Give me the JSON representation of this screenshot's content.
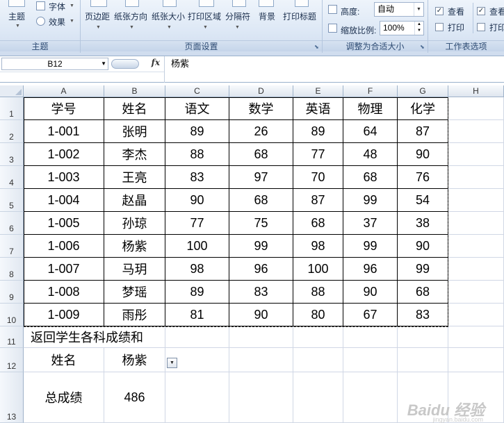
{
  "ribbon": {
    "themes_group": {
      "label": "主题",
      "theme_button": "主题",
      "fonts_button": "字体",
      "effects_button": "效果"
    },
    "page_setup_group": {
      "label": "页面设置",
      "buttons": [
        "页边距",
        "纸张方向",
        "纸张大小",
        "打印区域",
        "分隔符",
        "背景",
        "打印标题"
      ]
    },
    "scale_group": {
      "label": "调整为合适大小",
      "height_label": "高度:",
      "height_value": "自动",
      "scale_label": "缩放比例:",
      "scale_value": "100%"
    },
    "sheet_options_group": {
      "label": "工作表选项",
      "view_label": "查看",
      "print_label": "打印",
      "view_label_2": "查看",
      "print_label_2": "打印",
      "view_checked": true,
      "print_checked": false
    }
  },
  "formula_bar": {
    "name_box": "B12",
    "fx_label": "fx",
    "value": "杨紫"
  },
  "grid": {
    "columns": [
      "A",
      "B",
      "C",
      "D",
      "E",
      "F",
      "G",
      "H"
    ],
    "rows": [
      "1",
      "2",
      "3",
      "4",
      "5",
      "6",
      "7",
      "8",
      "9",
      "10",
      "11",
      "12",
      "13"
    ],
    "table_header": [
      "学号",
      "姓名",
      "语文",
      "数学",
      "英语",
      "物理",
      "化学"
    ],
    "table_rows": [
      [
        "1-001",
        "张明",
        "89",
        "26",
        "89",
        "64",
        "87"
      ],
      [
        "1-002",
        "李杰",
        "88",
        "68",
        "77",
        "48",
        "90"
      ],
      [
        "1-003",
        "王亮",
        "83",
        "97",
        "70",
        "68",
        "76"
      ],
      [
        "1-004",
        "赵晶",
        "90",
        "68",
        "87",
        "99",
        "54"
      ],
      [
        "1-005",
        "孙琼",
        "77",
        "75",
        "68",
        "37",
        "38"
      ],
      [
        "1-006",
        "杨紫",
        "100",
        "99",
        "98",
        "99",
        "90"
      ],
      [
        "1-007",
        "马玥",
        "98",
        "96",
        "100",
        "96",
        "99"
      ],
      [
        "1-008",
        "梦瑶",
        "89",
        "83",
        "88",
        "90",
        "68"
      ],
      [
        "1-009",
        "雨彤",
        "81",
        "90",
        "80",
        "67",
        "83"
      ]
    ],
    "a11_title": "返回学生各科成绩和",
    "a12_label": "姓名",
    "b12_value": "杨紫",
    "a13_label": "总成绩",
    "b13_value": "486"
  },
  "watermark": {
    "text": "Baidu 经验",
    "sub": "jingyan.baidu.com"
  }
}
